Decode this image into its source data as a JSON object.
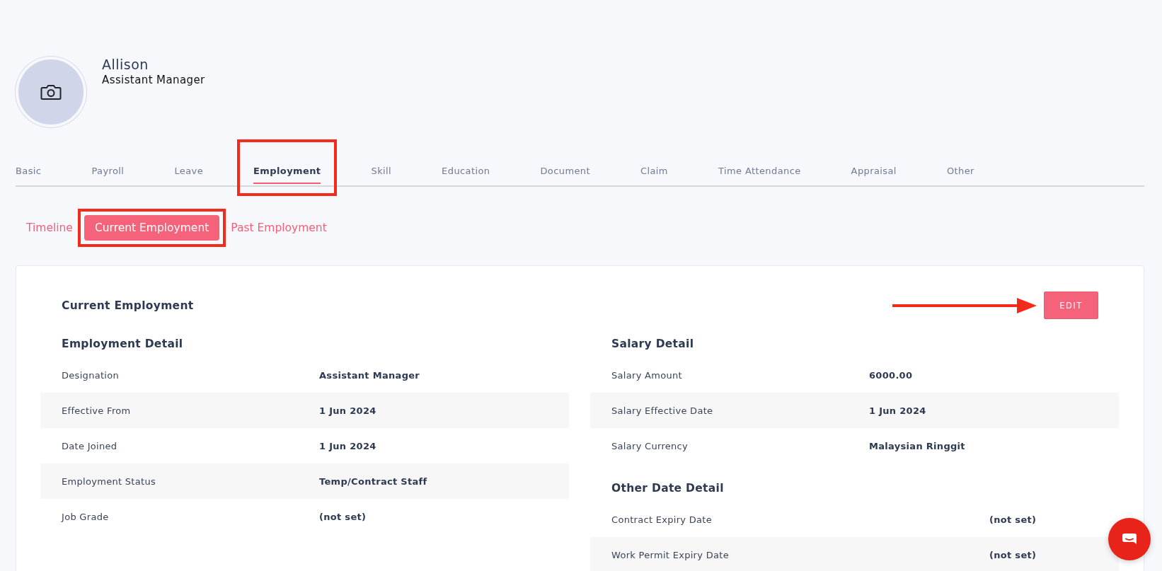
{
  "profile": {
    "name": "Allison",
    "position": "Assistant Manager"
  },
  "tabs": [
    {
      "label": "Basic",
      "selected": false
    },
    {
      "label": "Payroll",
      "selected": false
    },
    {
      "label": "Leave",
      "selected": false
    },
    {
      "label": "Employment",
      "selected": true,
      "highlighted": true
    },
    {
      "label": "Skill",
      "selected": false
    },
    {
      "label": "Education",
      "selected": false
    },
    {
      "label": "Document",
      "selected": false
    },
    {
      "label": "Claim",
      "selected": false
    },
    {
      "label": "Time Attendance",
      "selected": false
    },
    {
      "label": "Appraisal",
      "selected": false
    },
    {
      "label": "Other",
      "selected": false
    }
  ],
  "subtabs": [
    {
      "label": "Timeline",
      "selected": false
    },
    {
      "label": "Current Employment",
      "selected": true,
      "highlighted": true
    },
    {
      "label": "Past Employment",
      "selected": false
    }
  ],
  "card": {
    "title": "Current Employment",
    "edit_button": "EDIT",
    "edit_arrow": true,
    "left_column": [
      {
        "title": "Employment Detail",
        "rows": [
          {
            "label": "Designation",
            "value": "Assistant Manager"
          },
          {
            "label": "Effective From",
            "value": "1 Jun 2024"
          },
          {
            "label": "Date Joined",
            "value": "1 Jun 2024"
          },
          {
            "label": "Employment Status",
            "value": "Temp/Contract Staff"
          },
          {
            "label": "Job Grade",
            "value": "(not set)"
          }
        ]
      }
    ],
    "right_column": [
      {
        "title": "Salary Detail",
        "rows": [
          {
            "label": "Salary Amount",
            "value": "6000.00"
          },
          {
            "label": "Salary Effective Date",
            "value": "1 Jun 2024"
          },
          {
            "label": "Salary Currency",
            "value": "Malaysian Ringgit"
          }
        ]
      },
      {
        "title": "Other Date Detail",
        "wide_label": true,
        "rows": [
          {
            "label": "Contract Expiry Date",
            "value": "(not set)"
          },
          {
            "label": "Work Permit Expiry Date",
            "value": "(not set)"
          }
        ]
      }
    ]
  }
}
